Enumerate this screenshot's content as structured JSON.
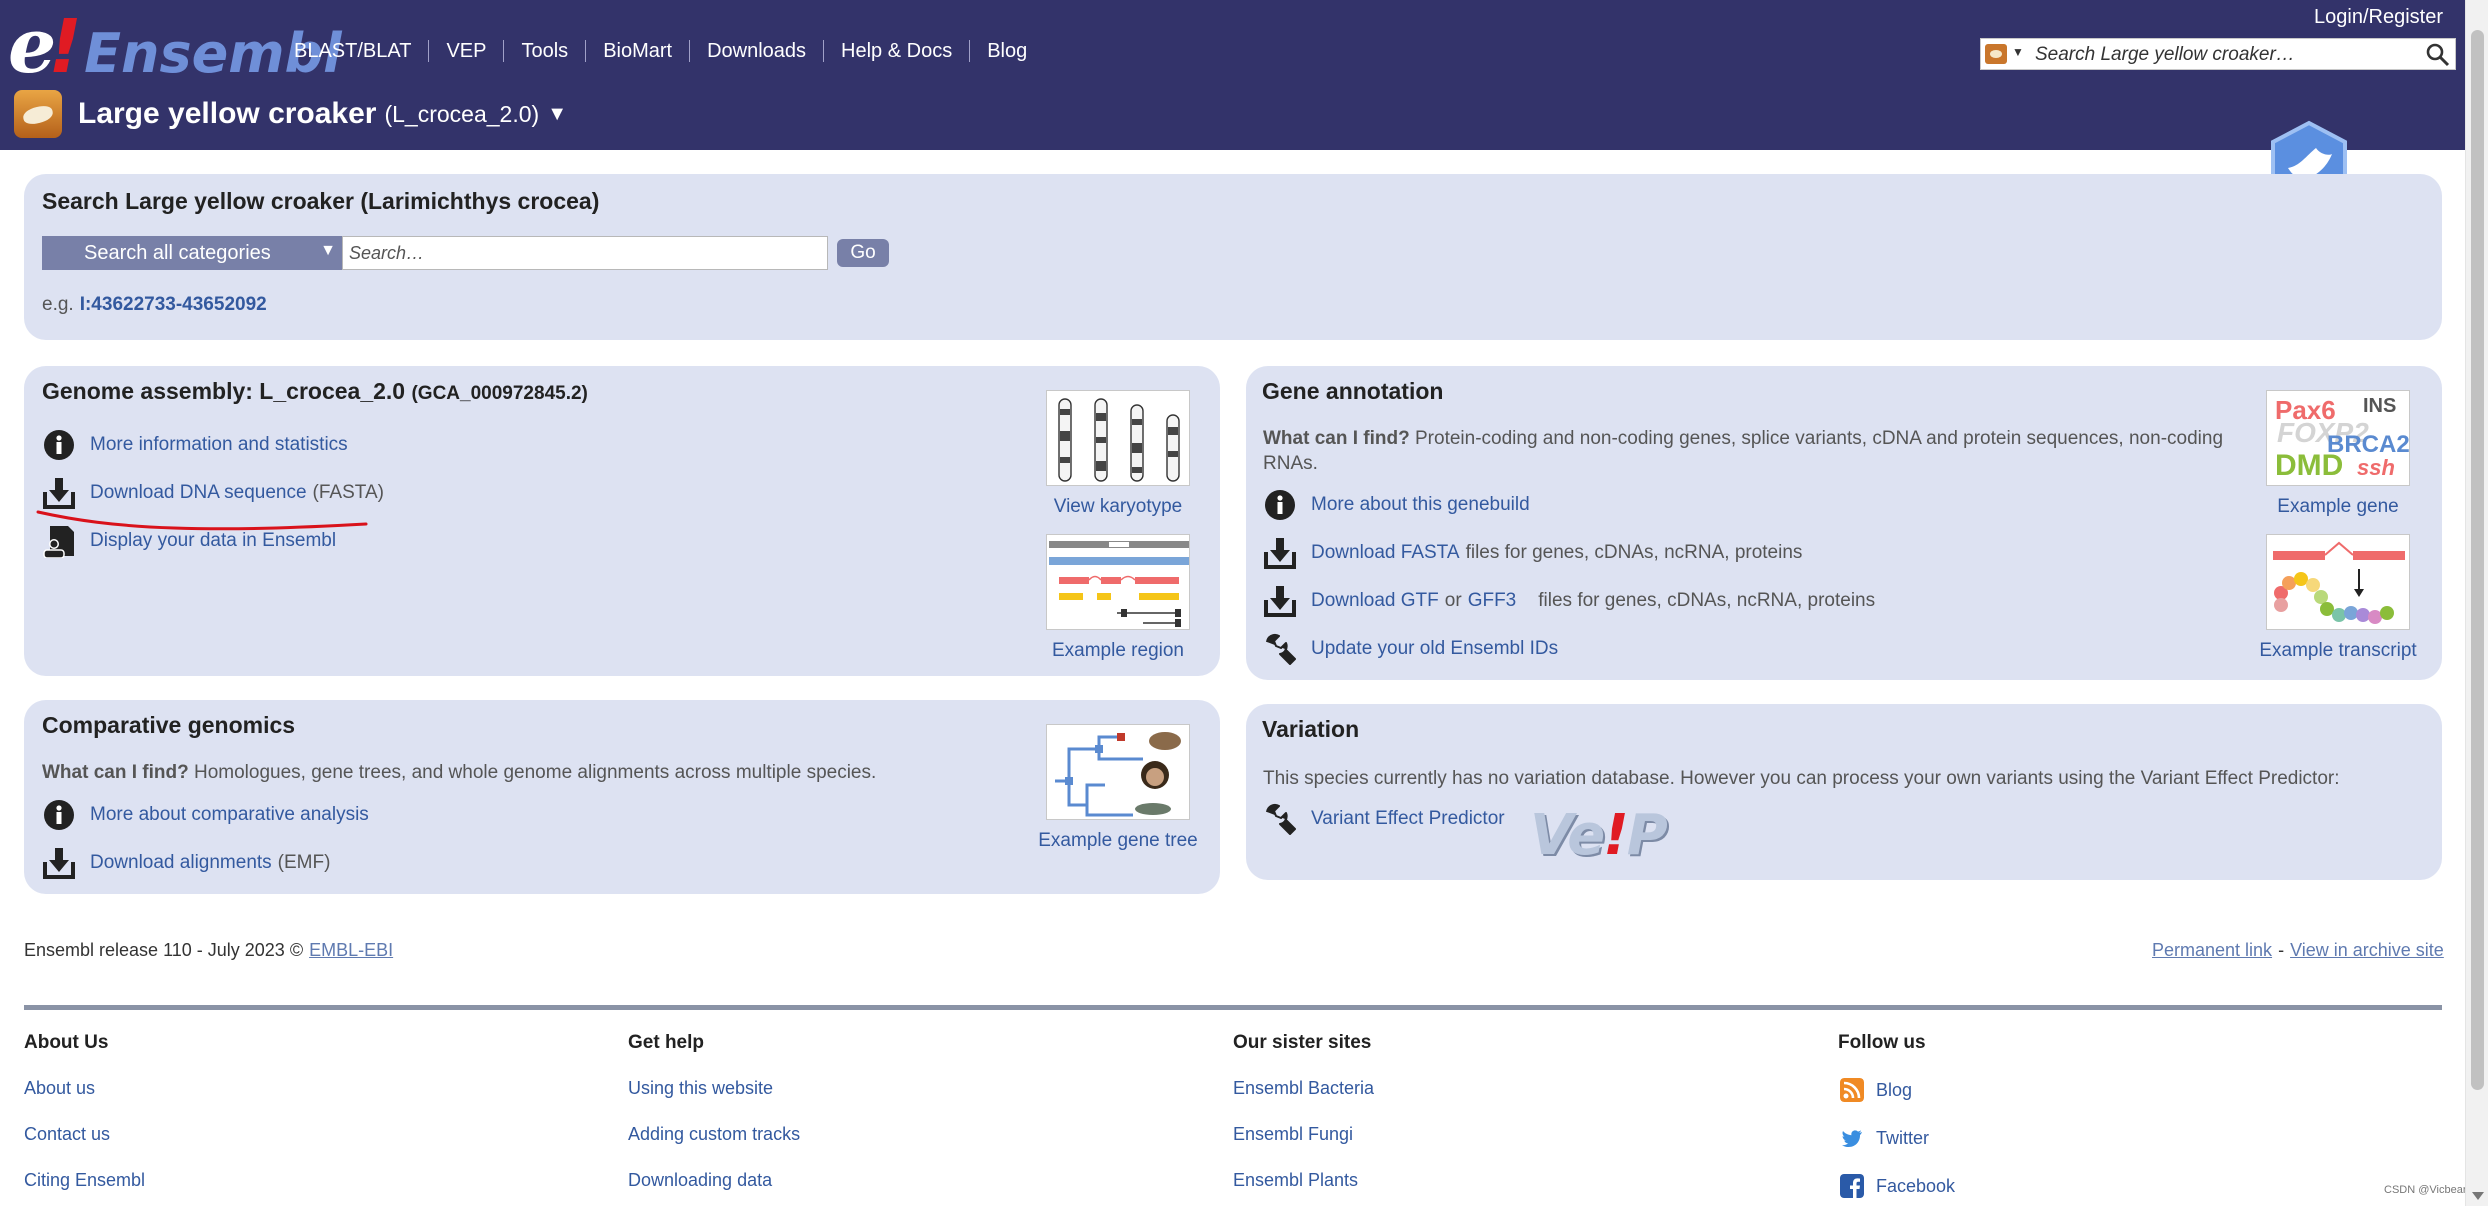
{
  "header": {
    "logo": {
      "e": "e",
      "bang": "!",
      "word": "Ensembl"
    },
    "nav": [
      "BLAST/BLAT",
      "VEP",
      "Tools",
      "BioMart",
      "Downloads",
      "Help & Docs",
      "Blog"
    ],
    "login": "Login/Register",
    "search_placeholder": "Search Large yellow croaker…",
    "species": {
      "name": "Large yellow croaker",
      "assembly": "(L_crocea_2.0)",
      "caret": "▼"
    }
  },
  "search_box": {
    "title": "Search Large yellow croaker (Larimichthys crocea)",
    "category": "Search all categories",
    "category_caret": "▼",
    "placeholder": "Search…",
    "go": "Go",
    "example_prefix": "e.g.",
    "example_link": "I:43622733-43652092"
  },
  "genome_assembly": {
    "title": "Genome assembly: L_crocea_2.0",
    "accession": "(GCA_000972845.2)",
    "links": [
      {
        "icon": "info-icon",
        "label": "More information and statistics",
        "suffix": ""
      },
      {
        "icon": "download-icon",
        "label": "Download DNA sequence",
        "suffix": "(FASTA)"
      },
      {
        "icon": "user-data-icon",
        "label": "Display your data in Ensembl",
        "suffix": ""
      }
    ],
    "thumbs": [
      "View karyotype",
      "Example region"
    ]
  },
  "gene_annotation": {
    "title": "Gene annotation",
    "question": "What can I find?",
    "description": "Protein-coding and non-coding genes, splice variants, cDNA and protein sequences, non-coding RNAs.",
    "links": [
      {
        "icon": "info-icon",
        "label": "More about this genebuild",
        "rest": ""
      },
      {
        "icon": "download-icon",
        "label": "Download FASTA",
        "rest": "files for genes, cDNAs, ncRNA, proteins"
      },
      {
        "icon": "download-icon",
        "label": "Download GTF",
        "or": "or",
        "label2": "GFF3",
        "rest": "files for genes, cDNAs, ncRNA, proteins"
      },
      {
        "icon": "wrench-icon",
        "label": "Update your old Ensembl IDs",
        "rest": ""
      }
    ],
    "thumbs": [
      "Example gene",
      "Example transcript"
    ],
    "gene_words": [
      "Pax6",
      "INS",
      "FOXP2",
      "BRCA2",
      "DMD",
      "ssh"
    ]
  },
  "comparative": {
    "title": "Comparative genomics",
    "question": "What can I find?",
    "description": "Homologues, gene trees, and whole genome alignments across multiple species.",
    "links": [
      {
        "icon": "info-icon",
        "label": "More about comparative analysis",
        "suffix": ""
      },
      {
        "icon": "download-icon",
        "label": "Download alignments",
        "suffix": "(EMF)"
      }
    ],
    "thumb": "Example gene tree"
  },
  "variation": {
    "title": "Variation",
    "description": "This species currently has no variation database. However you can process your own variants using the Variant Effect Predictor:",
    "link": "Variant Effect Predictor",
    "vep_logo": {
      "a": "Ve",
      "b": "!",
      "c": "P"
    }
  },
  "release": {
    "text": "Ensembl release 110 - July 2023 ©",
    "embl": "EMBL-EBI",
    "permanent": "Permanent link",
    "sep": "-",
    "archive": "View in archive site"
  },
  "footer": {
    "about": {
      "title": "About Us",
      "links": [
        "About us",
        "Contact us",
        "Citing Ensembl"
      ]
    },
    "help": {
      "title": "Get help",
      "links": [
        "Using this website",
        "Adding custom tracks",
        "Downloading data"
      ]
    },
    "sister": {
      "title": "Our sister sites",
      "links": [
        "Ensembl Bacteria",
        "Ensembl Fungi",
        "Ensembl Plants"
      ]
    },
    "follow": {
      "title": "Follow us",
      "links": [
        "Blog",
        "Twitter",
        "Facebook"
      ]
    }
  },
  "watermark": "CSDN @Vicbear",
  "colors": {
    "masthead": "#33336a",
    "panel": "#dde2f2",
    "link": "#33599f",
    "button": "#7880a8",
    "annotation_red": "#d9121b"
  }
}
